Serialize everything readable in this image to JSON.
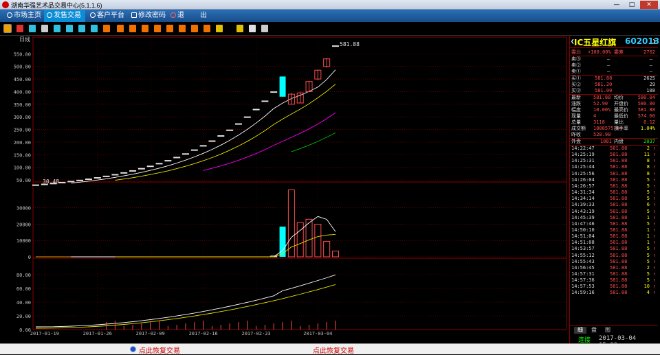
{
  "window": {
    "title": "湖南华强艺术品交易中心(5.1.1.6)",
    "minimize_label": "—",
    "maximize_label": "□",
    "close_label": "✕"
  },
  "menu": {
    "items": [
      {
        "label": "市场主页",
        "icon": "home-icon",
        "active": false
      },
      {
        "label": "发售交易",
        "icon": "trade-icon",
        "active": true
      },
      {
        "label": "客户平台",
        "icon": "client-icon",
        "active": false
      },
      {
        "label": "修改密码",
        "icon": "key-icon",
        "active": false
      },
      {
        "label": "退",
        "icon": "power-icon",
        "active": false
      },
      {
        "label": "出",
        "icon": "",
        "active": false
      }
    ]
  },
  "toolbar": {
    "icons": [
      {
        "name": "bar-chart-icon",
        "color": "#f0a000"
      },
      {
        "name": "line-chart-icon",
        "color": "#e03030"
      },
      {
        "name": "candle-chart-icon",
        "color": "#30c0e0"
      },
      {
        "name": "table-icon",
        "color": "#cccccc"
      },
      {
        "name": "grid-icon",
        "color": "#30c0e0"
      },
      {
        "name": "list-icon",
        "color": "#30c0e0"
      },
      {
        "name": "window-icon",
        "color": "#30c0e0"
      },
      {
        "name": "close-doc-icon",
        "color": "#30c0e0"
      },
      {
        "name": "period-1-icon",
        "color": "#f07000"
      },
      {
        "name": "period-5-icon",
        "color": "#f07000"
      },
      {
        "name": "period-15-icon",
        "color": "#f07000"
      },
      {
        "name": "period-30-icon",
        "color": "#f07000"
      },
      {
        "name": "period-60-icon",
        "color": "#f07000"
      },
      {
        "name": "period-day-icon",
        "color": "#f07000"
      },
      {
        "name": "period-week-icon",
        "color": "#f07000"
      },
      {
        "name": "period-month-icon",
        "color": "#f07000"
      },
      {
        "name": "period-year-icon",
        "color": "#f07000"
      },
      {
        "name": "zoom-in-icon",
        "color": "#e0c000"
      },
      {
        "name": "zoom-out-icon",
        "color": "#e0c000"
      },
      {
        "name": "draw-tool-icon",
        "color": "#e0e0e0"
      },
      {
        "name": "gear-icon",
        "color": "#cccccc"
      }
    ]
  },
  "chart_data": [
    {
      "type": "candlestick",
      "panel_label": "日线",
      "ylim": [
        50,
        600
      ],
      "yticks": [
        50,
        100,
        150,
        200,
        250,
        300,
        350,
        400,
        450,
        500,
        550
      ],
      "ytick_labels": [
        "50.00",
        "100.00",
        "150.00",
        "200.00",
        "250.00",
        "300.00",
        "350.00",
        "400.00",
        "450.00",
        "500.00",
        "550.00"
      ],
      "annotations": {
        "high_label": "581.88",
        "low_label": "30.48"
      },
      "colors": {
        "up": "#ff4d4d",
        "down": "#00ffff",
        "flat": "#e0e0e0"
      },
      "bars": [
        {
          "o": 30.48,
          "c": 30.48,
          "h": 30.48,
          "l": 30.48
        },
        {
          "o": 33.53,
          "c": 33.53,
          "h": 33.53,
          "l": 33.53
        },
        {
          "o": 36.88,
          "c": 36.88,
          "h": 36.88,
          "l": 36.88
        },
        {
          "o": 40.57,
          "c": 40.57,
          "h": 40.57,
          "l": 40.57
        },
        {
          "o": 44.63,
          "c": 44.63,
          "h": 44.63,
          "l": 44.63
        },
        {
          "o": 49.09,
          "c": 49.09,
          "h": 49.09,
          "l": 49.09
        },
        {
          "o": 54.0,
          "c": 54.0,
          "h": 54.0,
          "l": 54.0
        },
        {
          "o": 59.4,
          "c": 59.4,
          "h": 59.4,
          "l": 59.4
        },
        {
          "o": 65.34,
          "c": 65.34,
          "h": 65.34,
          "l": 65.34
        },
        {
          "o": 71.87,
          "c": 71.87,
          "h": 71.87,
          "l": 71.87
        },
        {
          "o": 79.06,
          "c": 79.06,
          "h": 79.06,
          "l": 79.06
        },
        {
          "o": 86.97,
          "c": 86.97,
          "h": 86.97,
          "l": 86.97
        },
        {
          "o": 95.66,
          "c": 95.66,
          "h": 95.66,
          "l": 95.66
        },
        {
          "o": 105.23,
          "c": 105.23,
          "h": 105.23,
          "l": 105.23
        },
        {
          "o": 115.75,
          "c": 115.75,
          "h": 115.75,
          "l": 115.75
        },
        {
          "o": 127.33,
          "c": 127.33,
          "h": 127.33,
          "l": 127.33
        },
        {
          "o": 140.06,
          "c": 140.06,
          "h": 140.06,
          "l": 140.06
        },
        {
          "o": 154.07,
          "c": 154.07,
          "h": 154.07,
          "l": 154.07
        },
        {
          "o": 169.47,
          "c": 169.47,
          "h": 169.47,
          "l": 169.47
        },
        {
          "o": 186.42,
          "c": 186.42,
          "h": 186.42,
          "l": 186.42
        },
        {
          "o": 205.06,
          "c": 205.06,
          "h": 205.06,
          "l": 205.06
        },
        {
          "o": 225.57,
          "c": 225.57,
          "h": 225.57,
          "l": 225.57
        },
        {
          "o": 248.13,
          "c": 248.13,
          "h": 248.13,
          "l": 248.13
        },
        {
          "o": 272.94,
          "c": 272.94,
          "h": 272.94,
          "l": 272.94
        },
        {
          "o": 300.23,
          "c": 300.23,
          "h": 300.23,
          "l": 300.23
        },
        {
          "o": 330.26,
          "c": 330.26,
          "h": 330.26,
          "l": 330.26
        },
        {
          "o": 363.28,
          "c": 363.28,
          "h": 363.28,
          "l": 363.28
        },
        {
          "o": 399.61,
          "c": 399.61,
          "h": 399.61,
          "l": 399.61
        },
        {
          "o": 460.0,
          "c": 380.0,
          "h": 460.0,
          "l": 380.0
        },
        {
          "o": 350.0,
          "c": 390.0,
          "h": 395.0,
          "l": 350.0
        },
        {
          "o": 355.0,
          "c": 395.0,
          "h": 400.0,
          "l": 355.0
        },
        {
          "o": 400.0,
          "c": 440.0,
          "h": 442.0,
          "l": 398.0
        },
        {
          "o": 450.0,
          "c": 485.0,
          "h": 488.0,
          "l": 445.0
        },
        {
          "o": 500.0,
          "c": 530.0,
          "h": 532.0,
          "l": 495.0
        },
        {
          "o": 581.88,
          "c": 581.88,
          "h": 581.88,
          "l": 581.88
        }
      ]
    },
    {
      "type": "bar",
      "panel_label": "volume",
      "ylim": [
        0,
        45000
      ],
      "yticks": [
        0,
        10000,
        20000,
        30000
      ],
      "ytick_labels": [
        "0",
        "10000",
        "20000",
        "30000"
      ],
      "values": [
        0,
        0,
        0,
        0,
        0,
        0,
        0,
        0,
        0,
        0,
        0,
        0,
        0,
        0,
        0,
        0,
        0,
        0,
        0,
        0,
        0,
        0,
        0,
        0,
        0,
        0,
        0,
        500,
        18500,
        41000,
        21000,
        23000,
        20000,
        9500,
        3500
      ],
      "directions": [
        "flat",
        "flat",
        "flat",
        "flat",
        "flat",
        "flat",
        "flat",
        "flat",
        "flat",
        "flat",
        "flat",
        "flat",
        "flat",
        "flat",
        "flat",
        "flat",
        "flat",
        "flat",
        "flat",
        "flat",
        "flat",
        "flat",
        "flat",
        "flat",
        "flat",
        "flat",
        "flat",
        "flat",
        "down",
        "up",
        "up",
        "up",
        "up",
        "up",
        "up"
      ]
    },
    {
      "type": "line",
      "panel_label": "indicator",
      "ylim": [
        0,
        100
      ],
      "yticks": [
        0,
        20,
        40,
        60,
        80
      ],
      "ytick_labels": [
        "0.00",
        "20.00",
        "40.00",
        "60.00",
        "80.00"
      ],
      "x_labels": [
        "2017-01-19",
        "2017-01-26",
        "2017-02-09",
        "2017-02-16",
        "2017-02-23",
        "2017-03-04"
      ],
      "x_label_index": [
        1,
        7,
        13,
        19,
        25,
        32
      ]
    }
  ],
  "quote": {
    "name": "IC五星红旗",
    "code": "602013",
    "weibi": {
      "label": "委比",
      "value": "+100.00%",
      "diff_label": "委差",
      "diff": "2762"
    },
    "sells": [
      {
        "label": "卖③",
        "price": "—",
        "qty": "—"
      },
      {
        "label": "卖②",
        "price": "—",
        "qty": "—"
      },
      {
        "label": "卖①",
        "price": "—",
        "qty": "—"
      }
    ],
    "buys": [
      {
        "label": "买①",
        "price": "581.88",
        "qty": "2625"
      },
      {
        "label": "买②",
        "price": "581.20",
        "qty": "29"
      },
      {
        "label": "买③",
        "price": "581.00",
        "qty": "108"
      }
    ],
    "stats": [
      {
        "l1": "最新",
        "v1": "581.88",
        "l2": "均价",
        "v2": "580.04"
      },
      {
        "l1": "涨跌",
        "v1": "52.90",
        "l2": "开盘价",
        "v2": "580.00"
      },
      {
        "l1": "幅度",
        "v1": "10.00%",
        "l2": "最高价",
        "v2": "581.88"
      },
      {
        "l1": "现量",
        "v1": "4",
        "l2": "最低价",
        "v2": "574.60"
      },
      {
        "l1": "总量",
        "v1": "3118",
        "l2": "量比",
        "v2": "0.12"
      },
      {
        "l1": "成交额",
        "v1": "1808575.84",
        "l2": "换手率",
        "v2": "1.04%"
      },
      {
        "l1": "昨收",
        "v1": "528.98",
        "l2": "",
        "v2": ""
      }
    ],
    "outer": {
      "label": "外盘",
      "value": "1081",
      "inner_label": "内盘",
      "inner_value": "2037"
    },
    "ticks": [
      {
        "t": "14:22:47",
        "p": "581.88",
        "v": "2"
      },
      {
        "t": "14:25:19",
        "p": "581.88",
        "v": "11"
      },
      {
        "t": "14:25:31",
        "p": "581.88",
        "v": "8"
      },
      {
        "t": "14:25:44",
        "p": "581.88",
        "v": "8"
      },
      {
        "t": "14:25:56",
        "p": "581.88",
        "v": "8"
      },
      {
        "t": "14:26:04",
        "p": "581.88",
        "v": "5"
      },
      {
        "t": "14:26:57",
        "p": "581.88",
        "v": "5"
      },
      {
        "t": "14:31:34",
        "p": "581.88",
        "v": "5"
      },
      {
        "t": "14:34:14",
        "p": "581.88",
        "v": "5"
      },
      {
        "t": "14:39:33",
        "p": "581.88",
        "v": "6"
      },
      {
        "t": "14:43:19",
        "p": "581.88",
        "v": "5"
      },
      {
        "t": "14:45:39",
        "p": "581.88",
        "v": "1"
      },
      {
        "t": "14:47:46",
        "p": "581.88",
        "v": "5"
      },
      {
        "t": "14:50:10",
        "p": "581.88",
        "v": "1"
      },
      {
        "t": "14:51:04",
        "p": "581.88",
        "v": "1"
      },
      {
        "t": "14:51:08",
        "p": "581.88",
        "v": "1"
      },
      {
        "t": "14:53:57",
        "p": "581.88",
        "v": "5"
      },
      {
        "t": "14:55:12",
        "p": "581.88",
        "v": "5"
      },
      {
        "t": "14:55:43",
        "p": "581.88",
        "v": "5"
      },
      {
        "t": "14:56:45",
        "p": "581.88",
        "v": "2"
      },
      {
        "t": "14:57:31",
        "p": "581.88",
        "v": "5"
      },
      {
        "t": "14:57:36",
        "p": "581.88",
        "v": "5"
      },
      {
        "t": "14:57:53",
        "p": "581.88",
        "v": "10"
      },
      {
        "t": "14:59:16",
        "p": "581.88",
        "v": "4"
      }
    ],
    "tabs": [
      "细",
      "盘",
      "图"
    ],
    "status": "连接",
    "datetime": "2017-03-04 15:00"
  },
  "footer": {
    "left_text": "点此恢复交易",
    "right_text": "点此恢复交易"
  },
  "colors": {
    "grid": "#8b0000",
    "axis_text": "#c0c0c0",
    "ma5": "#ffffff",
    "ma10": "#e6e600",
    "ma20": "#ff00ff",
    "ma30": "#00c000",
    "up": "#ff4d4d",
    "down": "#00ffff"
  }
}
